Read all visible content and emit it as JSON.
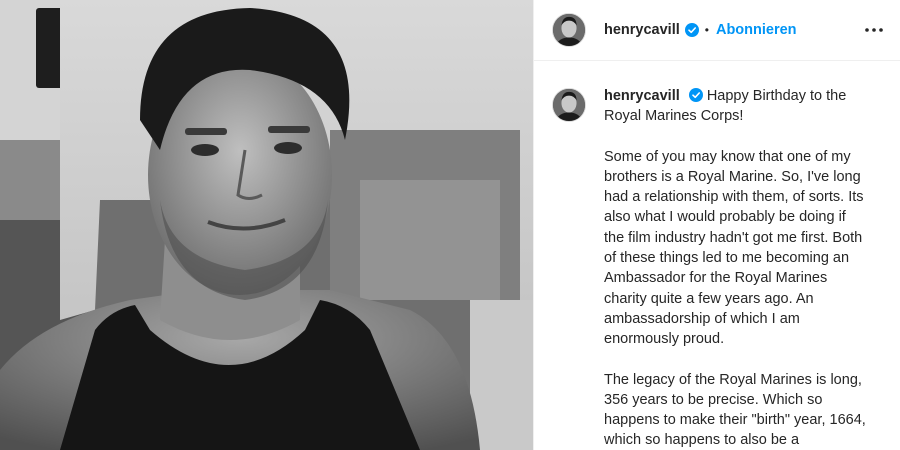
{
  "post": {
    "author": "henrycavill",
    "verified": true,
    "separator": "•",
    "follow_label": "Abonnieren",
    "more_icon": "more-horizontal-icon",
    "caption_first": "Happy Birthday to the Royal Marines Corps!",
    "caption_paragraphs": [
      "Some of you may know that one of my brothers is a Royal Marine. So, I've long had a relationship with them, of sorts. Its also what I would probably be doing if the film industry hadn't got me first. Both of these things led to me becoming an Ambassador for the Royal Marines charity quite a few years ago. An ambassadorship of which I am enormously proud.",
      "The legacy of the Royal Marines is long, 356 years to be precise. Which so happens to make their \"birth\" year, 1664, which so happens to also be a"
    ]
  },
  "colors": {
    "accent": "#0095f6",
    "verified": "#0095f6",
    "text": "#262626"
  }
}
